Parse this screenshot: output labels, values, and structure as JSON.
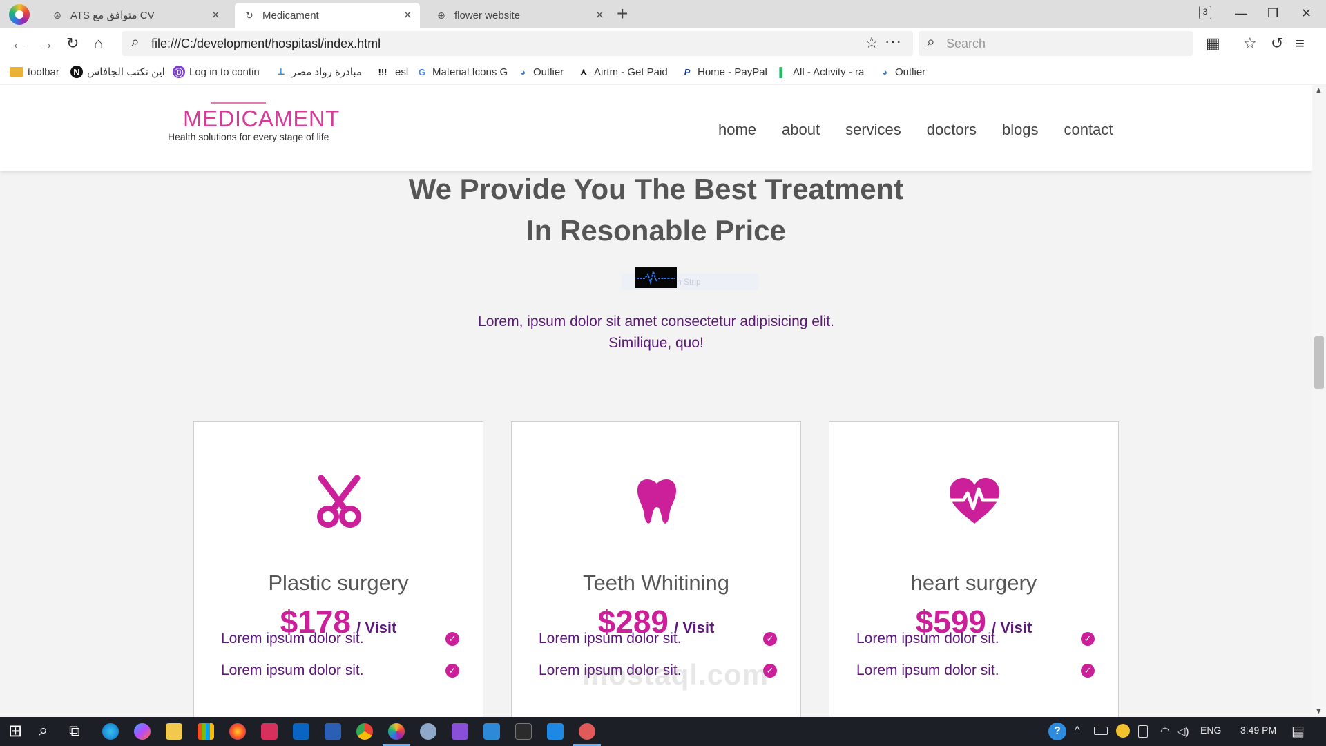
{
  "browser": {
    "tabs": [
      {
        "title": "ATS متوافق مع CV",
        "icon": "openai-icon",
        "glyph": "⊛"
      },
      {
        "title": "Medicament",
        "icon": "loading-icon",
        "glyph": "↻"
      },
      {
        "title": "flower website",
        "icon": "globe-icon",
        "glyph": "⊕"
      }
    ],
    "tab_close": "×",
    "new_tab": "+",
    "tab_count": "3",
    "window": {
      "minimize": "—",
      "restore": "❐",
      "close": "✕"
    },
    "url": "file:///C:/development/hospitasl/index.html",
    "search_placeholder": "Search",
    "nav_glyphs": {
      "back": "←",
      "forward": "→",
      "reload": "↻",
      "home": "⌂",
      "search": "⌕",
      "star": "☆",
      "more": "···",
      "apps": "▦",
      "favorites": "☆",
      "history": "↺",
      "menu": "≡"
    },
    "bookmarks": [
      {
        "label": "toolbar",
        "icon": "folder-icon",
        "glyph": ""
      },
      {
        "label": "اين تكتب الجافاس",
        "icon": "notion-icon",
        "glyph": "N"
      },
      {
        "label": "Log in to contin",
        "icon": "lock-icon",
        "glyph": "⓪"
      },
      {
        "label": "مبادرة رواد مصر",
        "icon": "site-icon",
        "glyph": "⊥"
      },
      {
        "label": "esl",
        "icon": "exclaim-icon",
        "glyph": "!!!"
      },
      {
        "label": "Material Icons G",
        "icon": "google-icon",
        "glyph": "G"
      },
      {
        "label": "Outlier",
        "icon": "outlier-icon",
        "glyph": "◕"
      },
      {
        "label": "Airtm - Get Paid",
        "icon": "airtm-icon",
        "glyph": "⋏"
      },
      {
        "label": "Home - PayPal",
        "icon": "paypal-icon",
        "glyph": "P"
      },
      {
        "label": "All - Activity - ra",
        "icon": "activity-icon",
        "glyph": "▌"
      },
      {
        "label": "Outlier",
        "icon": "outlier-icon",
        "glyph": "◕"
      }
    ]
  },
  "site": {
    "logo": {
      "name": "MEDICAMENT",
      "tagline": "Health solutions for every stage of life"
    },
    "nav": [
      "home",
      "about",
      "services",
      "doctors",
      "blogs",
      "contact"
    ],
    "heading": {
      "line1": "We Provide You The Best Treatment",
      "line2": "In Resonable Price"
    },
    "heading_image_caption": "n Strip",
    "subtext": {
      "line1": "Lorem, ipsum dolor sit amet consectetur adipisicing elit.",
      "line2": "Similique, quo!"
    },
    "colors": {
      "accent": "#cc1f9a",
      "text_purple": "#5c1a78",
      "heading": "#555555",
      "ekg_line": "#2e7bf0"
    },
    "cards": [
      {
        "icon": "scissors-icon",
        "name": "Plastic surgery",
        "price": "$178",
        "unit": "/ Visit",
        "features": [
          "Lorem ipsum dolor sit.",
          "Lorem ipsum dolor sit."
        ]
      },
      {
        "icon": "tooth-icon",
        "name": "Teeth Whitining",
        "price": "$289",
        "unit": "/ Visit",
        "features": [
          "Lorem ipsum dolor sit.",
          "Lorem ipsum dolor sit."
        ]
      },
      {
        "icon": "heartbeat-icon",
        "name": "heart surgery",
        "price": "$599",
        "unit": "/ Visit",
        "features": [
          "Lorem ipsum dolor sit.",
          "Lorem ipsum dolor sit."
        ]
      }
    ],
    "check_glyph": "✓",
    "watermark": "mostaql.com"
  },
  "taskbar": {
    "start_glyph": "⊞",
    "search_glyph": "⌕",
    "taskview_glyph": "⧉",
    "tray": {
      "help": "?",
      "chevron": "^",
      "lang": "ENG",
      "time": "3:49 PM",
      "notifications": "▤"
    }
  }
}
